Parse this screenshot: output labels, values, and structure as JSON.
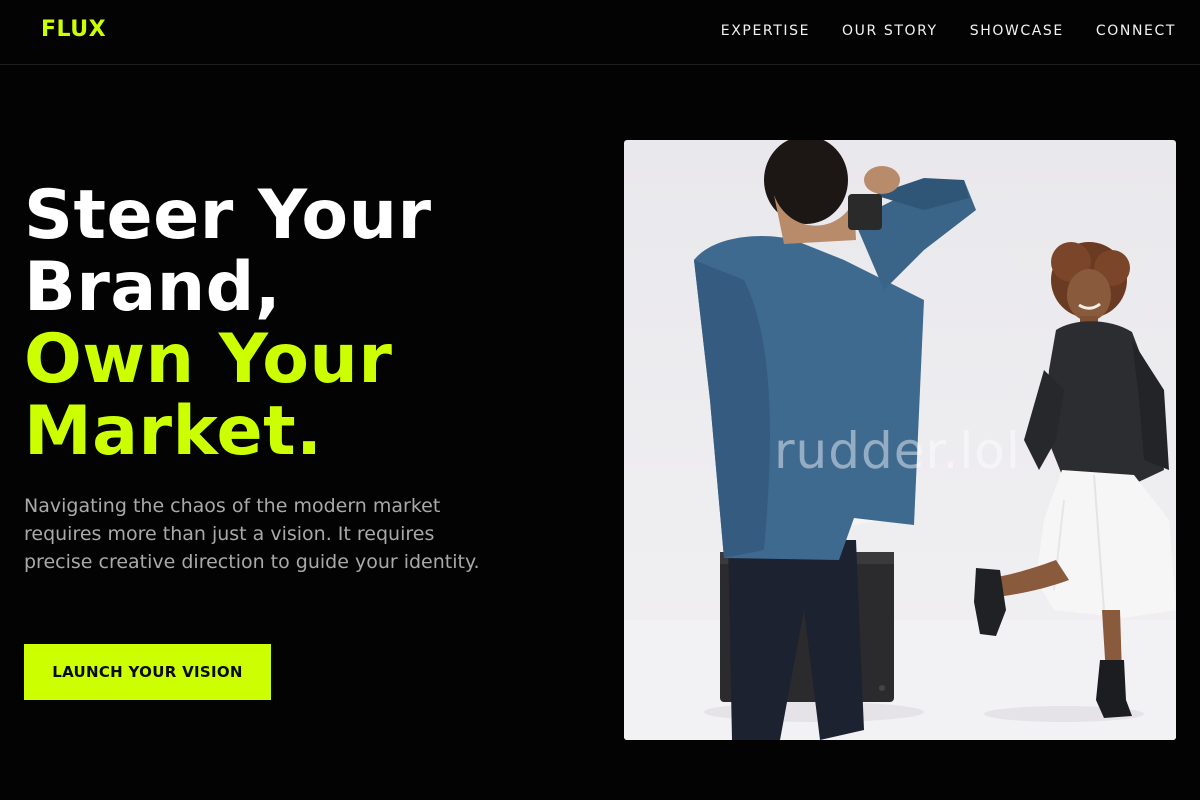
{
  "brand": {
    "name": "FLUX",
    "accent_color": "#ccff00"
  },
  "nav": {
    "items": [
      {
        "label": "EXPERTISE"
      },
      {
        "label": "OUR STORY"
      },
      {
        "label": "SHOWCASE"
      },
      {
        "label": "CONNECT"
      }
    ]
  },
  "hero": {
    "headline": {
      "line1": "Steer Your",
      "line2": "Brand,",
      "line3": "Own Your",
      "line4": "Market."
    },
    "description": "Navigating the chaos of the modern market requires more than just a vision. It requires precise creative direction to guide your identity.",
    "cta_label": "LAUNCH YOUR VISION",
    "image": {
      "subject": "photographer-shooting-model-photo",
      "watermark": "rudder.lol"
    }
  }
}
